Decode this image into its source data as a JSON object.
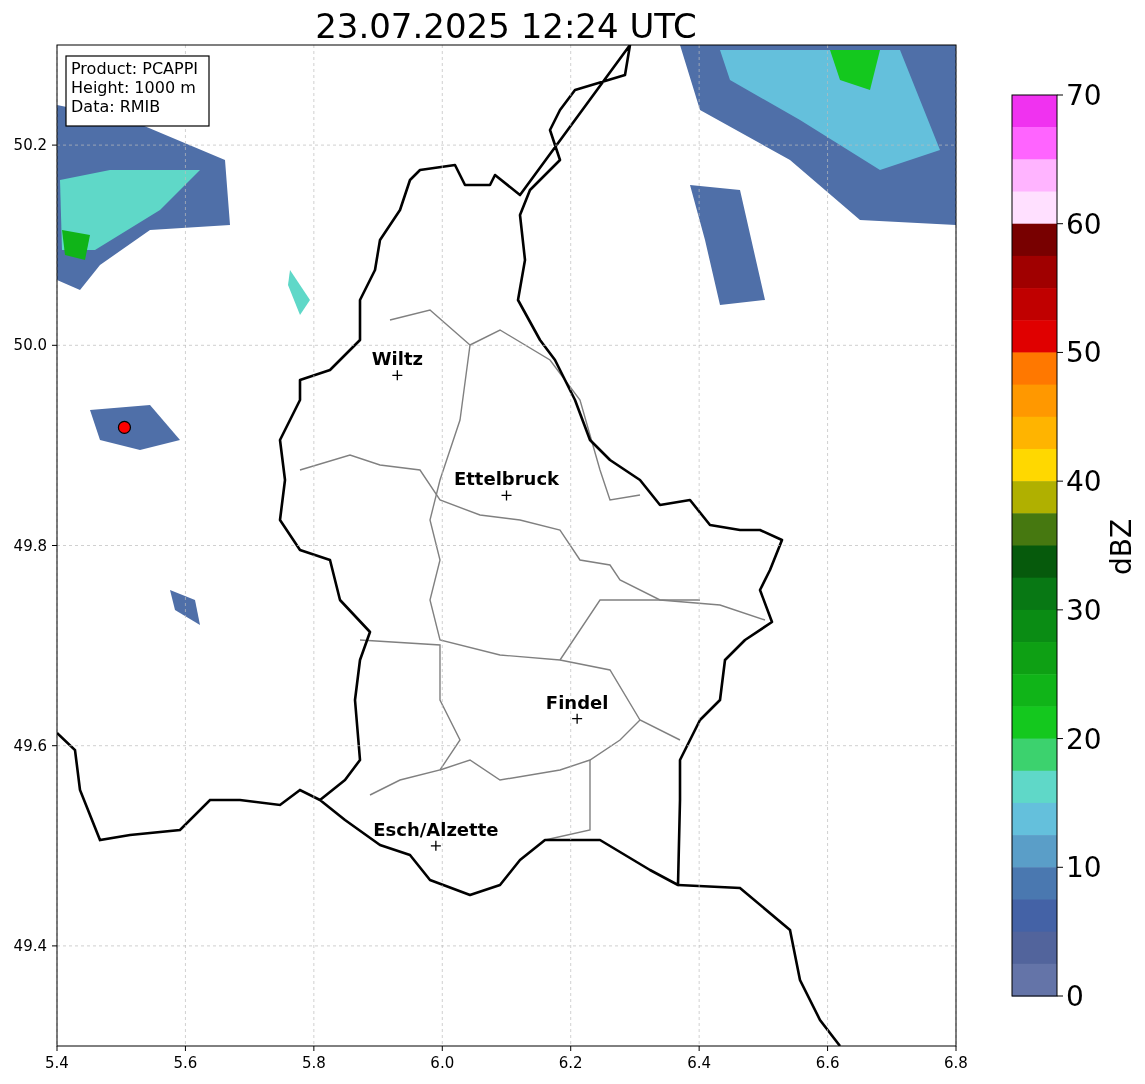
{
  "title": "23.07.2025 12:24 UTC",
  "info_box": [
    "Product: PCAPPI",
    "Height: 1000 m",
    "Data: RMIB"
  ],
  "map": {
    "chart_data": {
      "type": "scatter",
      "xlim": [
        5.4,
        6.8
      ],
      "ylim": [
        49.3,
        50.3
      ],
      "xticks": [
        {
          "value": 5.4,
          "label": "5.4"
        },
        {
          "value": 5.6,
          "label": "5.6"
        },
        {
          "value": 5.8,
          "label": "5.8"
        },
        {
          "value": 6.0,
          "label": "6.0"
        },
        {
          "value": 6.2,
          "label": "6.2"
        },
        {
          "value": 6.4,
          "label": "6.4"
        },
        {
          "value": 6.6,
          "label": "6.6"
        },
        {
          "value": 6.8,
          "label": "6.8"
        }
      ],
      "grid": true,
      "yticks": [
        {
          "value": 49.4,
          "label": "49.4"
        },
        {
          "value": 49.6,
          "label": "49.6"
        },
        {
          "value": 49.8,
          "label": "49.8"
        },
        {
          "value": 50.0,
          "label": "50.0"
        },
        {
          "value": 50.2,
          "label": "50.2"
        }
      ],
      "series": [
        {
          "color": "#000000",
          "x": [
            5.93,
            6.1,
            6.21,
            5.99
          ],
          "values": [
            49.97,
            49.85,
            49.627,
            49.5
          ]
        },
        {
          "color": "#ff0000",
          "x": [
            5.505
          ],
          "values": [
            49.918
          ]
        }
      ]
    },
    "city_labels": [
      "Wiltz",
      "Ettelbruck",
      "Findel",
      "Esch/Alzette"
    ]
  },
  "colorbar": {
    "label": "dBZ",
    "ticks": [
      "70",
      "60",
      "50",
      "40",
      "30",
      "20",
      "10",
      "0"
    ],
    "bins": [
      {
        "color": "#f032f0"
      },
      {
        "color": "#ff64ff"
      },
      {
        "color": "#ffb4ff"
      },
      {
        "color": "#ffe0ff"
      },
      {
        "color": "#780000"
      },
      {
        "color": "#a00000"
      },
      {
        "color": "#c00000"
      },
      {
        "color": "#e00000"
      },
      {
        "color": "#ff7800"
      },
      {
        "color": "#ff9800"
      },
      {
        "color": "#ffb400"
      },
      {
        "color": "#ffd800"
      },
      {
        "color": "#b0b000"
      },
      {
        "color": "#467810"
      },
      {
        "color": "#065a0c"
      },
      {
        "color": "#087814"
      },
      {
        "color": "#0a8c14"
      },
      {
        "color": "#0ea014"
      },
      {
        "color": "#10b418"
      },
      {
        "color": "#14c81e"
      },
      {
        "color": "#3cd26e"
      },
      {
        "color": "#5fd8c8"
      },
      {
        "color": "#64c0dc"
      },
      {
        "color": "#5a9ec8"
      },
      {
        "color": "#4a78b0"
      },
      {
        "color": "#4462a6"
      },
      {
        "color": "#52649c"
      },
      {
        "color": "#6474a8"
      }
    ]
  }
}
